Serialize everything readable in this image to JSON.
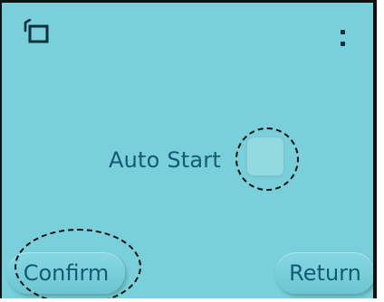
{
  "screen": {
    "background_color": "#79d0da",
    "text_color": "#155a75"
  },
  "header": {
    "back_icon": "back-icon",
    "menu_icon": "more-vertical-icon"
  },
  "settings": {
    "auto_start_label": "Auto Start",
    "auto_start_checked": false
  },
  "footer": {
    "confirm_label": "Confirm",
    "return_label": "Return"
  }
}
